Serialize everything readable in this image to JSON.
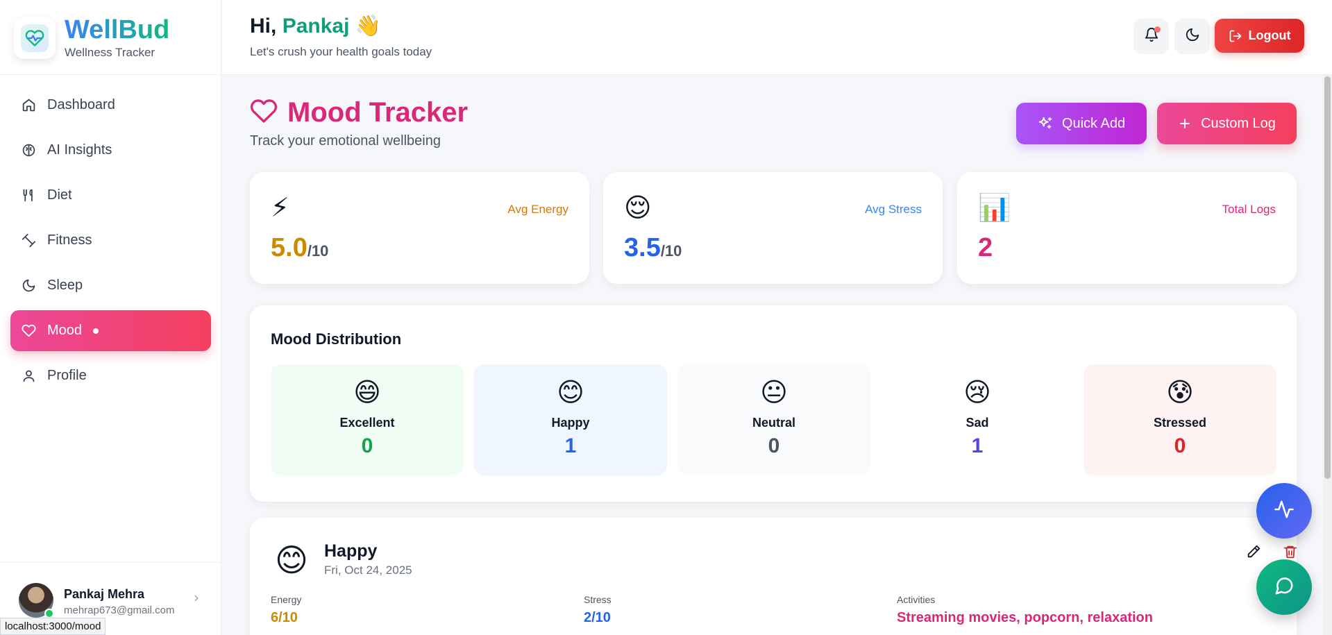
{
  "brand": {
    "name": "WellBud",
    "subtitle": "Wellness Tracker"
  },
  "sidebar": {
    "items": [
      {
        "label": "Dashboard",
        "icon": "home-icon"
      },
      {
        "label": "AI Insights",
        "icon": "brain-icon"
      },
      {
        "label": "Diet",
        "icon": "utensils-icon"
      },
      {
        "label": "Fitness",
        "icon": "dumbbell-icon"
      },
      {
        "label": "Sleep",
        "icon": "moon-icon"
      },
      {
        "label": "Mood",
        "icon": "heart-icon",
        "active": true
      },
      {
        "label": "Profile",
        "icon": "user-icon"
      }
    ],
    "user": {
      "name": "Pankaj Mehra",
      "email": "mehrap673@gmail.com"
    }
  },
  "status_url": "localhost:3000/mood",
  "header": {
    "greeting_prefix": "Hi,",
    "user_first_name": "Pankaj",
    "wave": "👋",
    "subtitle": "Let's crush your health goals today",
    "logout_label": "Logout"
  },
  "page": {
    "title": "Mood Tracker",
    "subtitle": "Track your emotional wellbeing",
    "quick_add_label": "Quick Add",
    "custom_log_label": "Custom Log"
  },
  "stats": [
    {
      "emoji": "⚡",
      "label": "Avg Energy",
      "value": "5.0",
      "suffix": "/10",
      "color": "#ca8a04"
    },
    {
      "emoji": "😌",
      "label": "Avg Stress",
      "value": "3.5",
      "suffix": "/10",
      "color": "#2563eb"
    },
    {
      "emoji": "📊",
      "label": "Total Logs",
      "value": "2",
      "suffix": "",
      "color": "#db2777"
    }
  ],
  "distribution": {
    "title": "Mood Distribution",
    "items": [
      {
        "emoji": "😄",
        "label": "Excellent",
        "count": "0",
        "bg": "#f0fdf4",
        "color": "#16a34a"
      },
      {
        "emoji": "😊",
        "label": "Happy",
        "count": "1",
        "bg": "#eff6ff",
        "color": "#2563eb"
      },
      {
        "emoji": "😐",
        "label": "Neutral",
        "count": "0",
        "bg": "#f9fafb",
        "color": "#4b5563"
      },
      {
        "emoji": "😢",
        "label": "Sad",
        "count": "1",
        "bg": "#ffffff",
        "color": "#4f46e5"
      },
      {
        "emoji": "😰",
        "label": "Stressed",
        "count": "0",
        "bg": "#fef2f2",
        "color": "#dc2626"
      }
    ]
  },
  "entry": {
    "emoji": "😊",
    "mood": "Happy",
    "date": "Fri, Oct 24, 2025",
    "energy_label": "Energy",
    "energy_value": "6/10",
    "stress_label": "Stress",
    "stress_value": "2/10",
    "activities_label": "Activities",
    "activities_value": "Streaming movies, popcorn, relaxation"
  },
  "colors": {
    "brand_green": "#10b981",
    "brand_blue": "#3b82f6",
    "accent_pink": "#db2777",
    "logout_red": "#ef4444"
  }
}
